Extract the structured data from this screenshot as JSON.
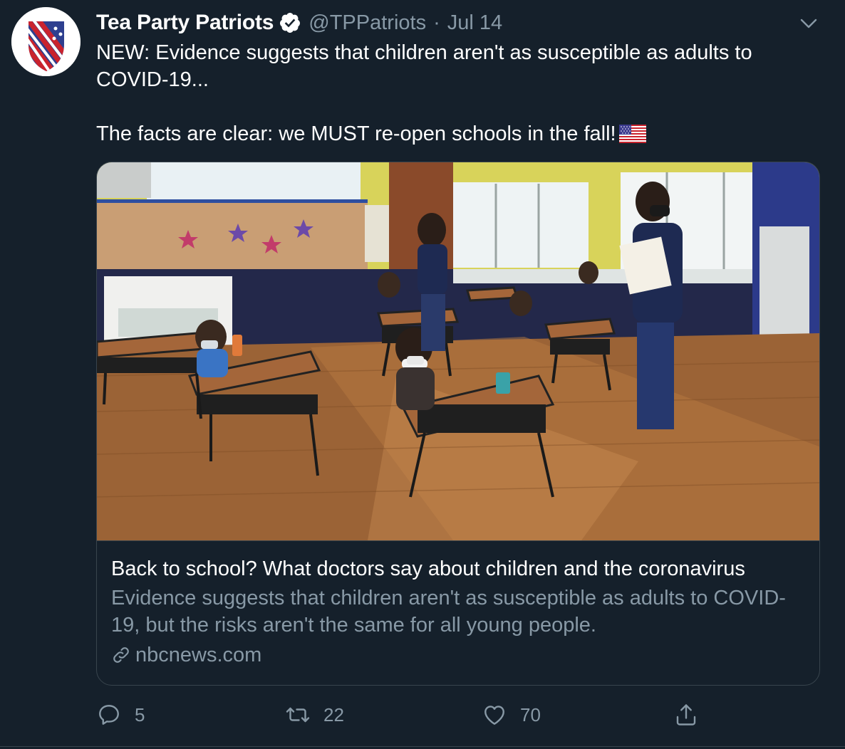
{
  "author": {
    "display_name": "Tea Party Patriots",
    "handle": "@TPPatriots",
    "separator": "·",
    "date": "Jul 14",
    "verified": true,
    "avatar_icon": "shield-flag-logo"
  },
  "tweet": {
    "line1": "NEW: Evidence suggests that children aren't as susceptible as adults to COVID-19...",
    "line2": "The facts are clear: we MUST re-open schools in the fall!",
    "emoji": "us-flag-emoji"
  },
  "card": {
    "image_icon": "classroom-photo",
    "title": "Back to school? What doctors say about children and the coronavirus",
    "description": "Evidence suggests that children aren't as susceptible as adults to COVID-19, but the risks aren't the same for all young people.",
    "domain": "nbcnews.com"
  },
  "actions": {
    "reply_count": "5",
    "retweet_count": "22",
    "like_count": "70"
  },
  "colors": {
    "background": "#15202b",
    "border": "#38444d",
    "secondary_text": "#8899a6",
    "primary_text": "#ffffff"
  }
}
